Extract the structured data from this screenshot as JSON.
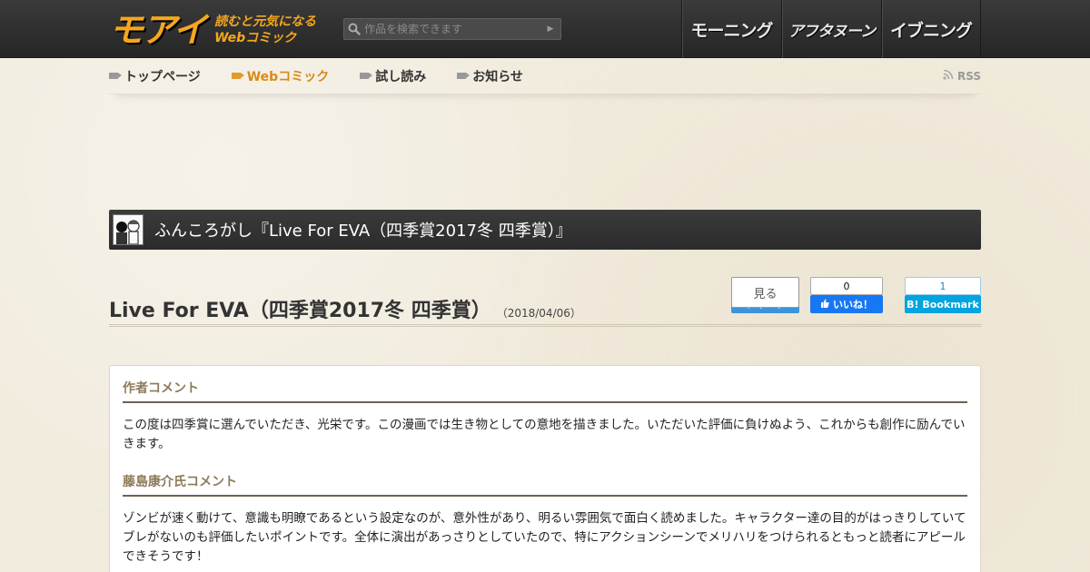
{
  "header": {
    "logo_mark": "モアイ",
    "logo_tag_line1": "読むと元気になる",
    "logo_tag_line2": "Webコミック",
    "search_placeholder": "作品を検索できます",
    "brands": [
      "モーニング",
      "アフタヌーン",
      "イブニング"
    ]
  },
  "subnav": {
    "items": [
      {
        "label": "トップページ",
        "active": false
      },
      {
        "label": "Webコミック",
        "active": true
      },
      {
        "label": "試し読み",
        "active": false
      },
      {
        "label": "お知らせ",
        "active": false
      }
    ],
    "rss_label": "RSS"
  },
  "series": {
    "title": "ふんころがし『Live For EVA（四季賞2017冬 四季賞）』"
  },
  "episode": {
    "title": "Live For EVA（四季賞2017冬 四季賞）",
    "date": "（2018/04/06）"
  },
  "share": {
    "tweet_label": "見る",
    "tweet_sub": "ツイート",
    "fb_count": "0",
    "fb_label": "いいね！",
    "hb_count": "1",
    "hb_label": "B! Bookmark"
  },
  "comments": [
    {
      "heading": "作者コメント",
      "text": "この度は四季賞に選んでいただき、光栄です。この漫画では生き物としての意地を描きました。いただいた評価に負けぬよう、これからも創作に励んでいきます。"
    },
    {
      "heading": "藤島康介氏コメント",
      "text": "ゾンビが速く動けて、意識も明瞭であるという設定なのが、意外性があり、明るい雰囲気で面白く読めました。キャラクター達の目的がはっきりしていてブレがないのも評価したいポイントです。全体に演出があっさりとしていたので、特にアクションシーンでメリハリをつけられるともっと読者にアピールできそうです！"
    }
  ],
  "colors": {
    "accent": "#f5a71e",
    "active_nav": "#d98a14",
    "header_bg": "#2e2e2e",
    "page_bg": "#f1ebdd"
  }
}
